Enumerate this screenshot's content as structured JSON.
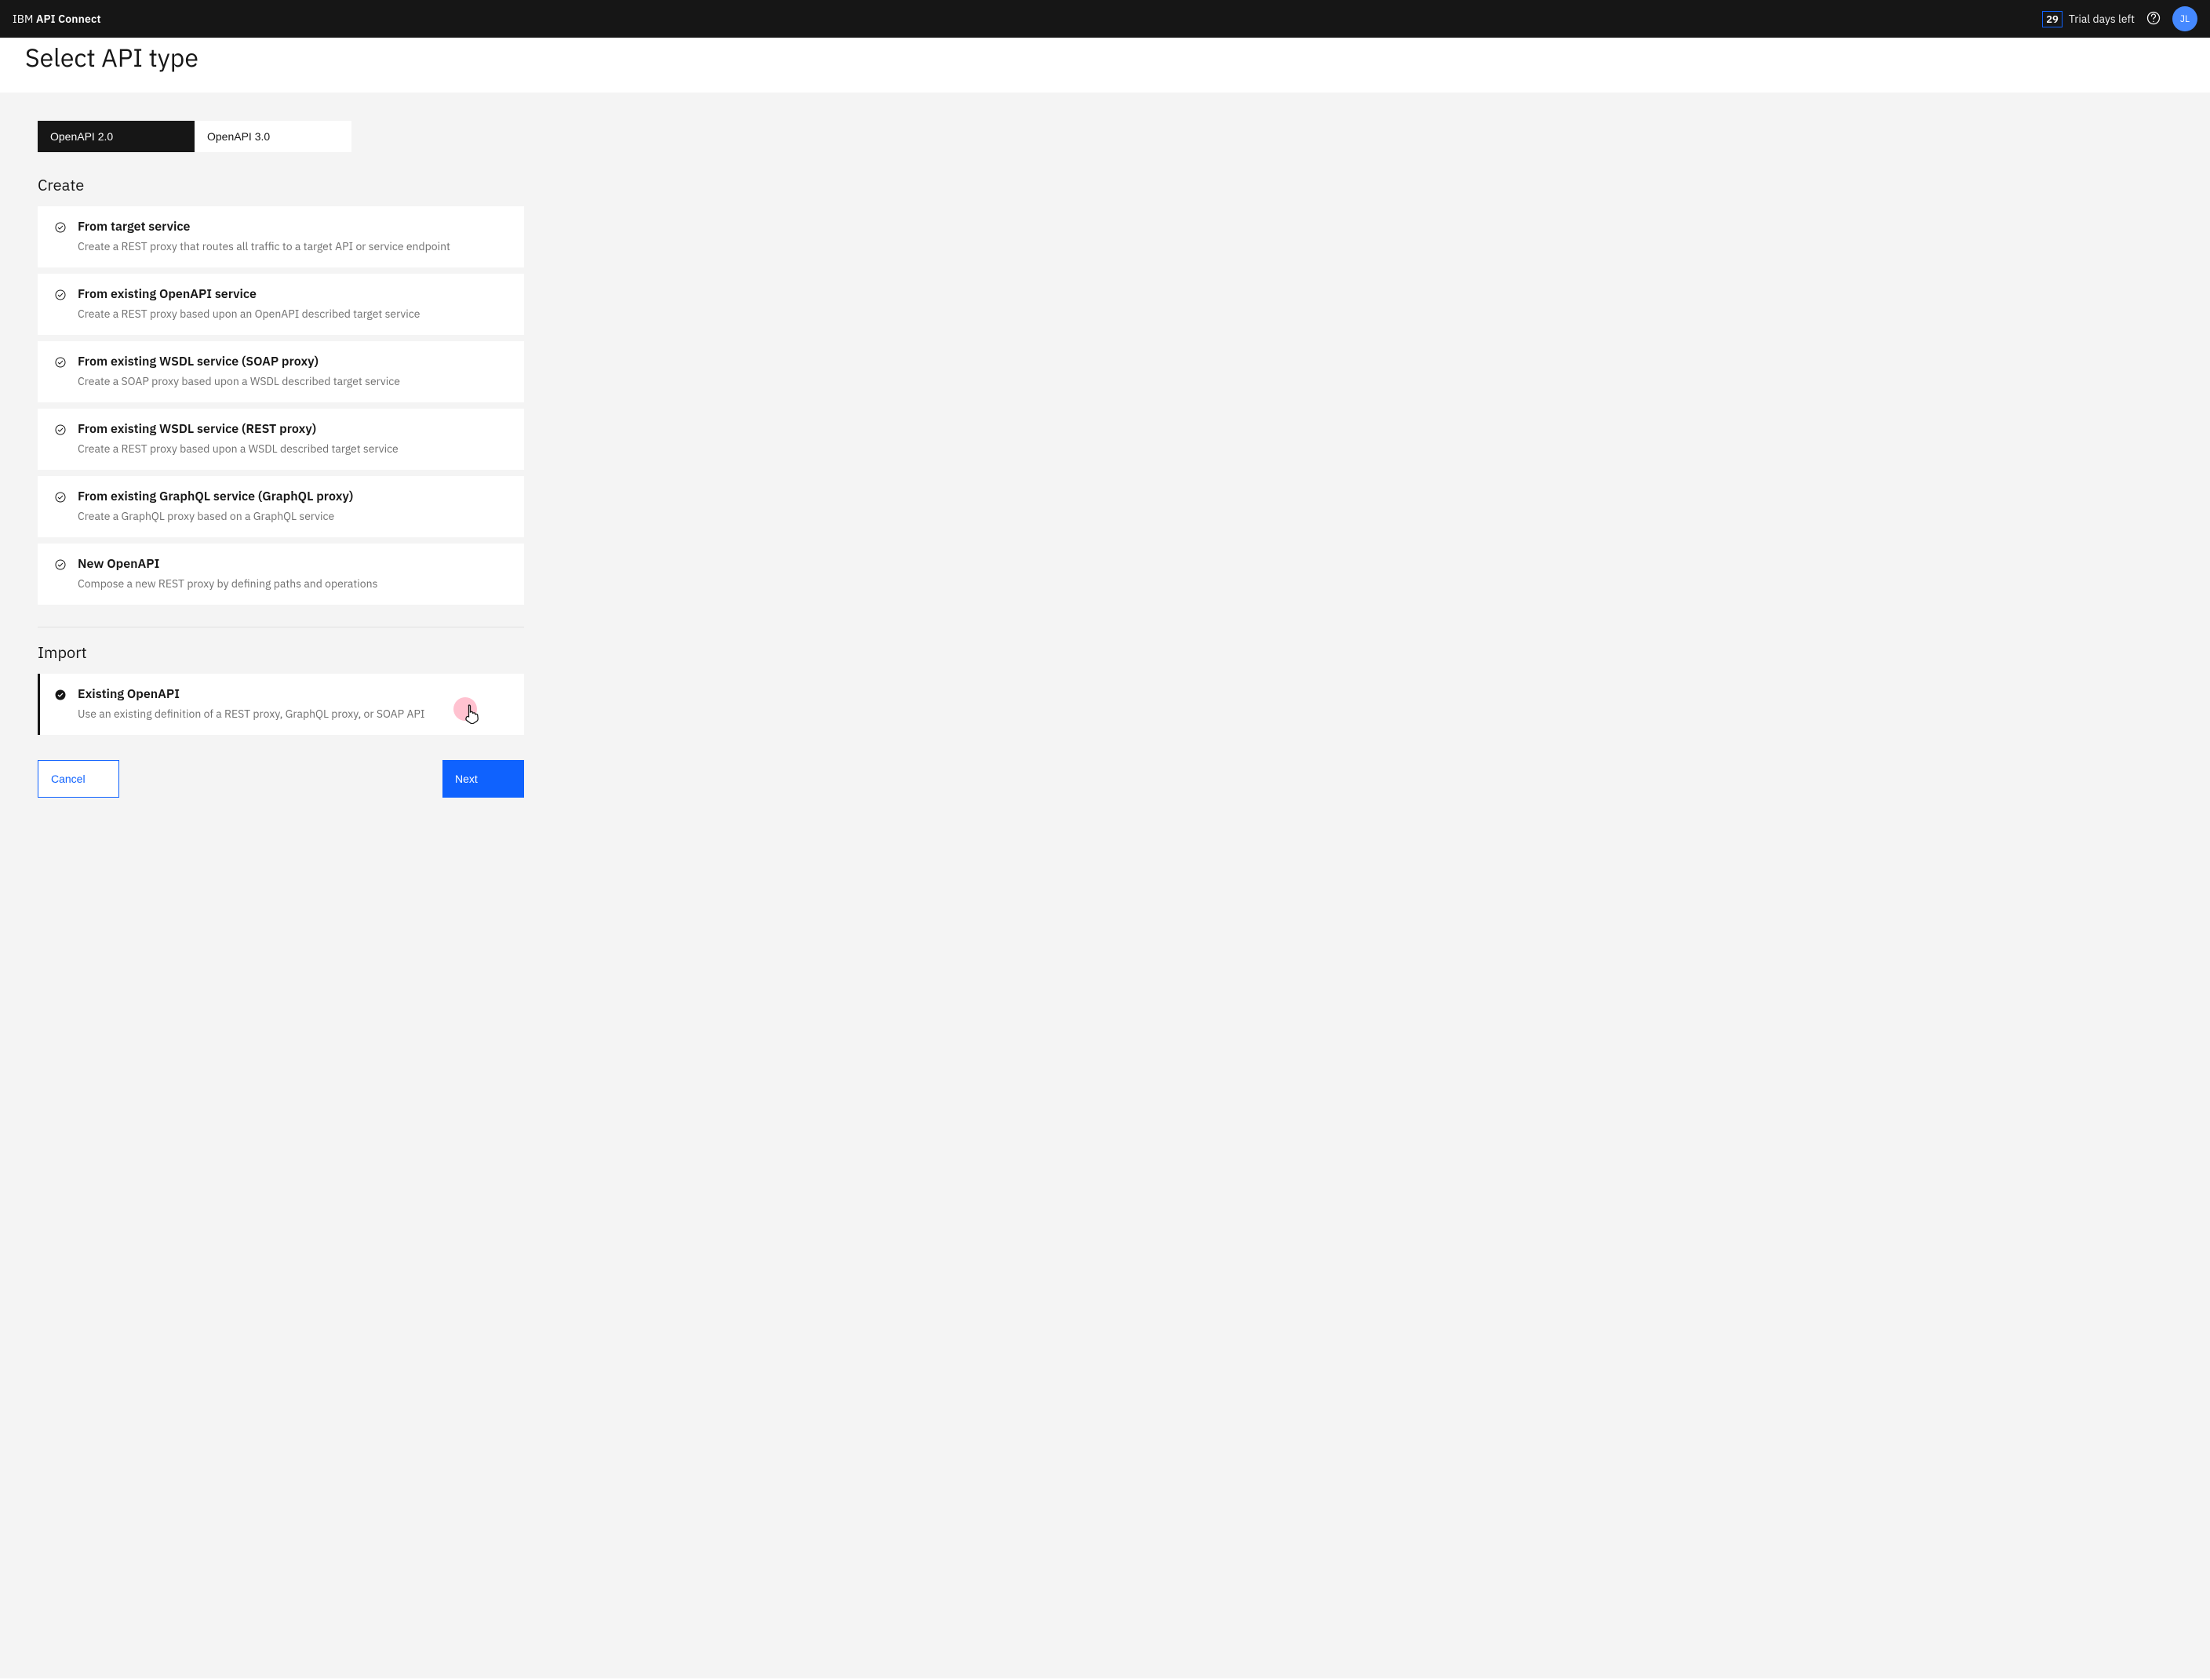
{
  "header": {
    "brand_prefix": "IBM ",
    "brand_bold": "API Connect",
    "trial_days": "29",
    "trial_label": "Trial days left",
    "avatar_initials": "JL"
  },
  "page": {
    "title": "Select API type"
  },
  "tabs": [
    {
      "label": "OpenAPI 2.0",
      "active": true
    },
    {
      "label": "OpenAPI 3.0",
      "active": false
    }
  ],
  "create": {
    "heading": "Create",
    "options": [
      {
        "title": "From target service",
        "desc": "Create a REST proxy that routes all traffic to a target API or service endpoint"
      },
      {
        "title": "From existing OpenAPI service",
        "desc": "Create a REST proxy based upon an OpenAPI described target service"
      },
      {
        "title": "From existing WSDL service (SOAP proxy)",
        "desc": "Create a SOAP proxy based upon a WSDL described target service"
      },
      {
        "title": "From existing WSDL service (REST proxy)",
        "desc": "Create a REST proxy based upon a WSDL described target service"
      },
      {
        "title": "From existing GraphQL service (GraphQL proxy)",
        "desc": "Create a GraphQL proxy based on a GraphQL service"
      },
      {
        "title": "New OpenAPI",
        "desc": "Compose a new REST proxy by defining paths and operations"
      }
    ]
  },
  "import": {
    "heading": "Import",
    "options": [
      {
        "title": "Existing OpenAPI",
        "desc": "Use an existing definition of a REST proxy, GraphQL proxy, or SOAP API",
        "selected": true
      }
    ]
  },
  "actions": {
    "cancel": "Cancel",
    "next": "Next"
  }
}
